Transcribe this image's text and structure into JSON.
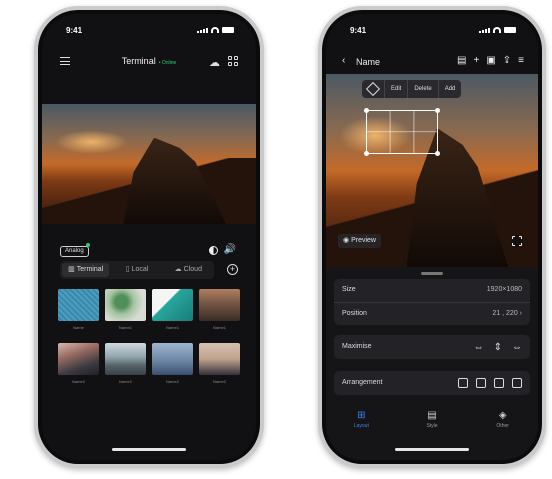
{
  "status_time": "9:41",
  "left_phone": {
    "title": "Terminal",
    "title_badge": "• Online",
    "preview_pill": "Analog",
    "tabs": [
      {
        "label": "Terminal",
        "icon": "terminal-icon",
        "active": true
      },
      {
        "label": "Local",
        "icon": "phone-icon",
        "active": false
      },
      {
        "label": "Cloud",
        "icon": "cloud-icon",
        "active": false
      }
    ],
    "thumbnails": [
      {
        "caption": "Name",
        "style": "water"
      },
      {
        "caption": "Name1",
        "style": "leaf"
      },
      {
        "caption": "Name1",
        "style": "mint"
      },
      {
        "caption": "Name1",
        "style": "town"
      },
      {
        "caption": "Name2",
        "style": "palm"
      },
      {
        "caption": "Name2",
        "style": "lake"
      },
      {
        "caption": "Name2",
        "style": "plane"
      },
      {
        "caption": "Name2",
        "style": "city"
      }
    ]
  },
  "right_phone": {
    "back_label": "Name",
    "edit_actions": [
      "Edit",
      "Delete",
      "Add"
    ],
    "preview_label": "Preview",
    "properties": {
      "size_label": "Size",
      "size_value": "1920×1080",
      "position_label": "Position",
      "position_value": "21 , 220",
      "maximise_label": "Maximise",
      "arrangement_label": "Arrangement"
    },
    "tabbar": [
      {
        "label": "Layout",
        "icon": "layout-icon",
        "active": true
      },
      {
        "label": "Style",
        "icon": "style-icon",
        "active": false
      },
      {
        "label": "Other",
        "icon": "layers-icon",
        "active": false
      }
    ]
  },
  "colors": {
    "accent": "#3b82f6",
    "online": "#2ecc71",
    "screen_bg": "#111113"
  }
}
